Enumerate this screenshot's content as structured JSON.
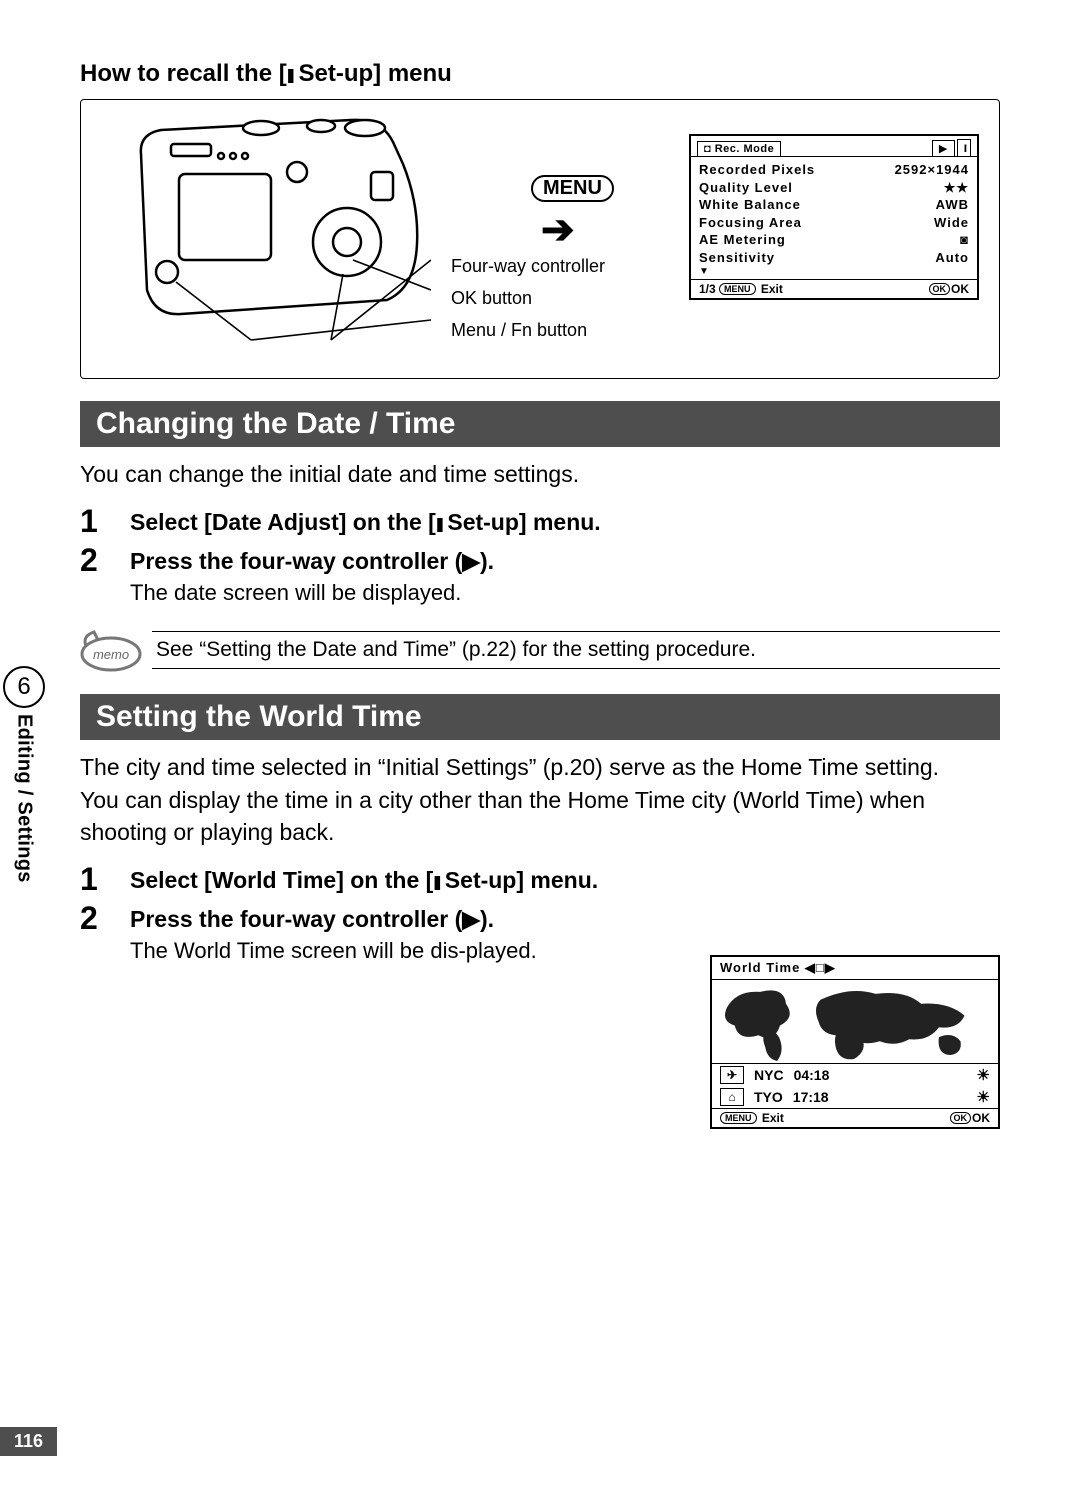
{
  "top_heading_prefix": "How to recall the [",
  "top_heading_suffix": " Set-up] menu",
  "recall": {
    "menu_pill": "MENU",
    "labels": [
      "Four-way controller",
      "OK button",
      "Menu / Fn  button"
    ]
  },
  "lcd": {
    "mode": "Rec. Mode",
    "rows": [
      {
        "k": "Recorded Pixels",
        "v": "2592×1944"
      },
      {
        "k": "Quality Level",
        "v": "★★"
      },
      {
        "k": "White Balance",
        "v": "AWB"
      },
      {
        "k": "Focusing Area",
        "v": "Wide"
      },
      {
        "k": "AE Metering",
        "v": "◙"
      },
      {
        "k": "Sensitivity",
        "v": "Auto"
      }
    ],
    "foot_left_pre": "1/3 ",
    "foot_left_exit": "Exit",
    "foot_right": "OK"
  },
  "sec1": {
    "title": "Changing the Date / Time",
    "intro": "You can change the initial date and time settings.",
    "step1_pre": "Select [Date Adjust] on the [",
    "step1_suf": " Set-up] menu.",
    "step2": "Press the four-way controller (▶).",
    "step2_sub": "The date screen will be displayed.",
    "memo": "See “Setting the Date and Time” (p.22) for the setting procedure."
  },
  "sec2": {
    "title": "Setting the World Time",
    "p1": "The city and time selected in “Initial Settings” (p.20) serve as the Home Time setting.",
    "p2": "You can display the time in a city other than the Home Time city (World Time) when shooting or playing back.",
    "step1_pre": "Select [World Time] on the [",
    "step1_suf": " Set-up] menu.",
    "step2": "Press the four-way controller (▶).",
    "step2_sub": "The World Time screen will be dis-played."
  },
  "world": {
    "header": "World Time ◀□▶",
    "rows": [
      {
        "icon": "✈",
        "city": "NYC",
        "time": "04:18"
      },
      {
        "icon": "⌂",
        "city": "TYO",
        "time": "17:18"
      }
    ],
    "foot_exit": "Exit",
    "foot_ok": "OK"
  },
  "side": {
    "chapter": "6",
    "label": "Editing / Settings"
  },
  "page_num": "116",
  "nums": {
    "one": "1",
    "two": "2"
  }
}
